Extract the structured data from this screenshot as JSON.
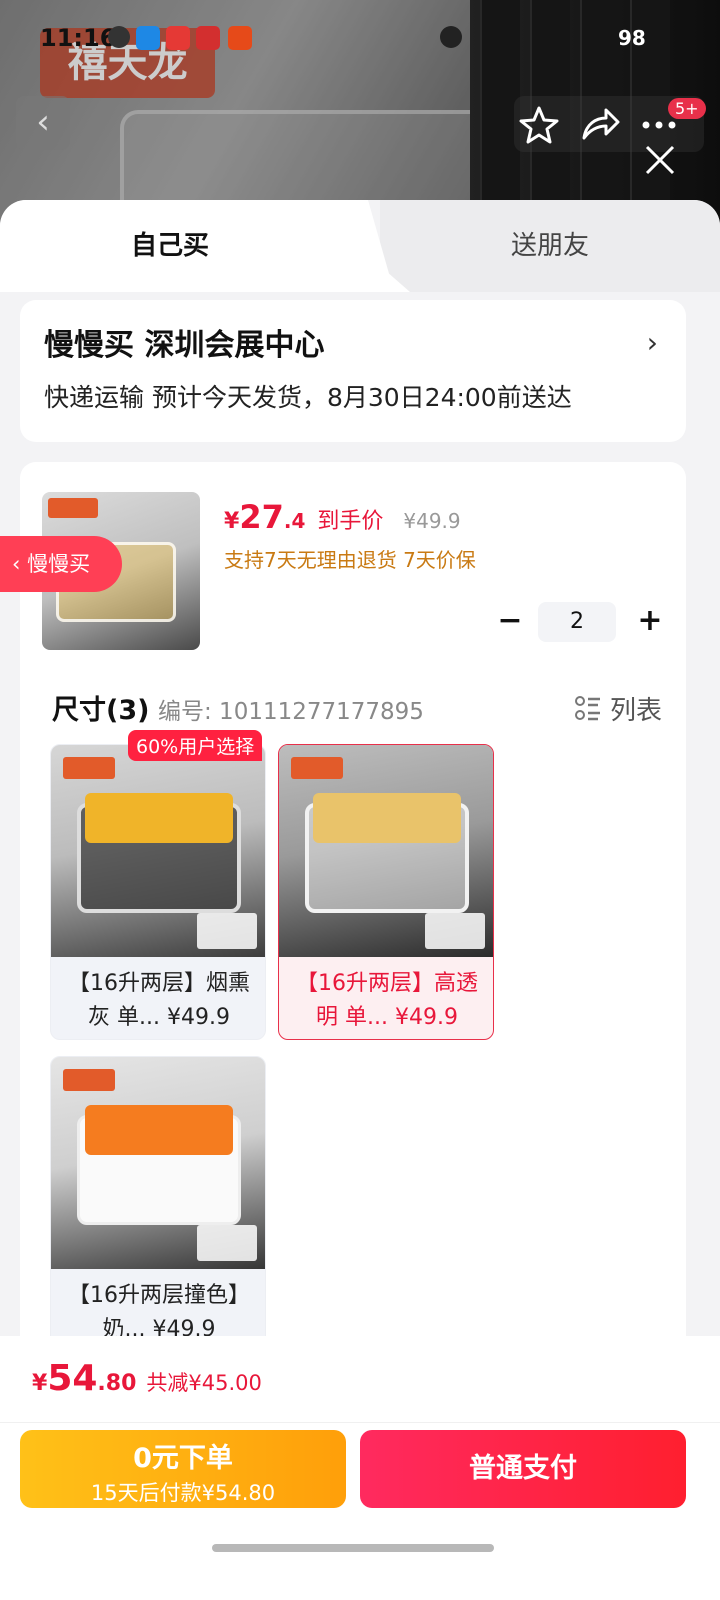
{
  "status_bar": {
    "time": "11:16",
    "battery": "98"
  },
  "header": {
    "brand_logo": "禧天龙",
    "badge_count": "5+"
  },
  "tabs": [
    {
      "label": "自己买"
    },
    {
      "label": "送朋友"
    }
  ],
  "address": {
    "line1": "慢慢买  深圳会展中心",
    "line2": "快递运输 预计今天发货，8月30日24:00前送达"
  },
  "product": {
    "price_currency": "¥",
    "price_integer": "27",
    "price_decimal": ".4",
    "price_tag": "到手价",
    "original_price": "¥49.9",
    "promise": "支持7天无理由退货  7天价保",
    "quantity": "2",
    "size_title": "尺寸(3)",
    "item_code": "编号: 10111277177895",
    "list_label": "列表",
    "options": [
      {
        "name": "【16升两层】烟熏灰 单... ¥49.9",
        "tag": "60%用户选择"
      },
      {
        "name": "【16升两层】高透明 单... ¥49.9"
      },
      {
        "name": "【16升两层撞色】奶... ¥49.9"
      }
    ]
  },
  "side_pill": {
    "label": "慢慢买"
  },
  "bottom": {
    "total_currency": "¥",
    "total_integer": "54",
    "total_decimal": ".80",
    "savings": "共减¥45.00",
    "credit_button_l1": "0元下单",
    "credit_button_l2": "15天后付款¥54.80",
    "pay_button": "普通支付"
  }
}
